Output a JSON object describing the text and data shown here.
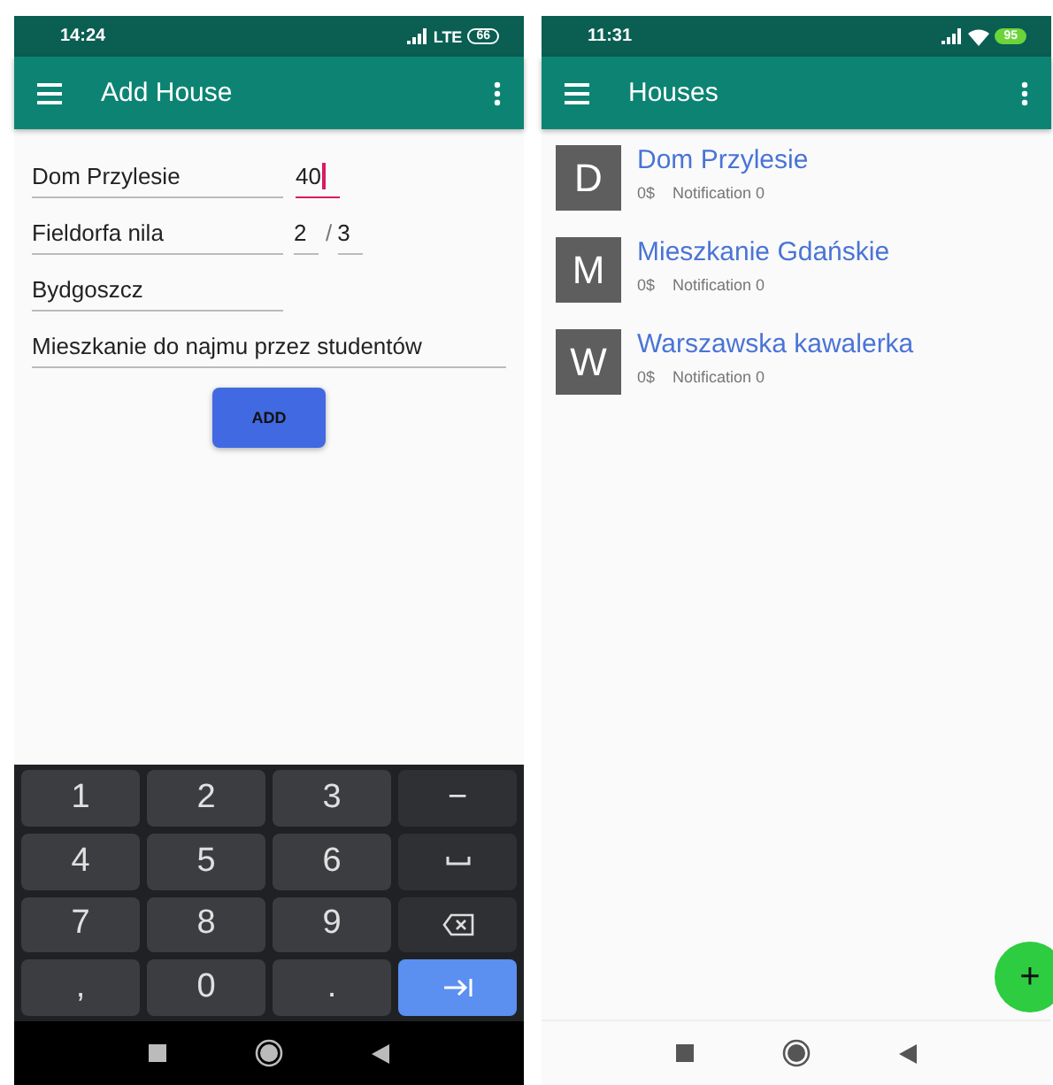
{
  "screens": [
    {
      "status_bar": {
        "time": "14:24",
        "network": "LTE",
        "battery": "66",
        "wifi": false
      },
      "app_bar": {
        "title": "Add House"
      },
      "form": {
        "rows": [
          {
            "fields": [
              {
                "kind": "name",
                "value": "Dom Przylesie",
                "focused": false
              },
              {
                "kind": "area",
                "value": "40",
                "focused": true
              }
            ]
          },
          {
            "fields": [
              {
                "kind": "street",
                "value": "Fieldorfa nila",
                "focused": false
              },
              {
                "kind": "building",
                "value": "2",
                "focused": false
              },
              {
                "kind": "flat",
                "value": "3",
                "focused": false,
                "separator": "/"
              }
            ]
          },
          {
            "fields": [
              {
                "kind": "city",
                "value": "Bydgoszcz",
                "focused": false
              }
            ]
          },
          {
            "fields": [
              {
                "kind": "description",
                "value": "Mieszkanie do najmu przez studentów",
                "focused": false
              }
            ]
          }
        ],
        "button": "ADD"
      },
      "keyboard": {
        "keys": [
          {
            "kind": "char",
            "label": "1",
            "highlighted": false
          },
          {
            "kind": "char",
            "label": "2",
            "highlighted": false
          },
          {
            "kind": "char",
            "label": "3",
            "highlighted": false
          },
          {
            "kind": "char",
            "label": "−",
            "highlighted": false
          },
          {
            "kind": "char",
            "label": "4",
            "highlighted": false
          },
          {
            "kind": "char",
            "label": "5",
            "highlighted": false
          },
          {
            "kind": "char",
            "label": "6",
            "highlighted": false
          },
          {
            "kind": "space",
            "highlighted": false
          },
          {
            "kind": "char",
            "label": "7",
            "highlighted": false
          },
          {
            "kind": "char",
            "label": "8",
            "highlighted": false
          },
          {
            "kind": "char",
            "label": "9",
            "highlighted": false
          },
          {
            "kind": "backspace",
            "highlighted": false
          },
          {
            "kind": "char",
            "label": ",",
            "highlighted": false
          },
          {
            "kind": "char",
            "label": "0",
            "highlighted": false
          },
          {
            "kind": "char",
            "label": ".",
            "highlighted": false
          },
          {
            "kind": "tab",
            "highlighted": true
          }
        ]
      },
      "nav_dark": true
    },
    {
      "status_bar": {
        "time": "11:31",
        "battery": "95",
        "wifi": true
      },
      "app_bar": {
        "title": "Houses"
      },
      "list": [
        {
          "letter": "D",
          "title": "Dom Przylesie",
          "price": "0$",
          "notification": "Notification 0"
        },
        {
          "letter": "M",
          "title": "Mieszkanie Gdańskie",
          "price": "0$",
          "notification": "Notification 0"
        },
        {
          "letter": "W",
          "title": "Warszawska kawalerka",
          "price": "0$",
          "notification": "Notification 0"
        }
      ],
      "fab": "+",
      "nav_dark": false
    }
  ]
}
